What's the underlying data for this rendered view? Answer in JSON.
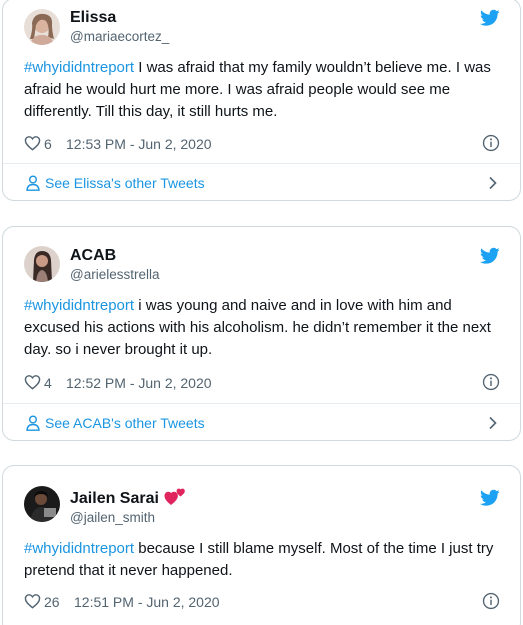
{
  "tweets": [
    {
      "name": "Elissa",
      "handle": "@mariaecortez_",
      "hashtag": "#whyididntreport",
      "body": " I was afraid that my family wouldn’t believe me. I was afraid he would hurt me more. I was afraid people would see me differently. Till this day, it still hurts me.",
      "likes": "6",
      "timestamp": "12:53 PM - Jun 2, 2020",
      "see_more": "See Elissa's other Tweets"
    },
    {
      "name": "ACAB",
      "handle": "@arielesstrella",
      "hashtag": "#whyididntreport",
      "body": " i was young and naive and in love with him and excused his actions with his alcoholism. he didn’t remember it the next day. so i never brought it up.",
      "likes": "4",
      "timestamp": "12:52 PM - Jun 2, 2020",
      "see_more": "See ACAB's other Tweets"
    },
    {
      "name": "Jailen Sarai",
      "handle": "@jailen_smith",
      "hashtag": "#whyididntreport",
      "body": " because I still blame myself. Most of the time I just try pretend that it never happened.",
      "likes": "26",
      "timestamp": "12:51 PM - Jun 2, 2020",
      "see_more": ""
    }
  ],
  "icons": {
    "brand": "twitter-bird-icon",
    "like": "heart-icon",
    "info": "info-icon",
    "profile": "person-icon",
    "chevron": "chevron-right-icon",
    "emoji": "two-hearts-emoji"
  },
  "colors": {
    "link": "#1b95e0",
    "brand": "#1da1f2",
    "muted": "#536471",
    "border": "#cfd9de",
    "emoji": "#e0245e"
  }
}
